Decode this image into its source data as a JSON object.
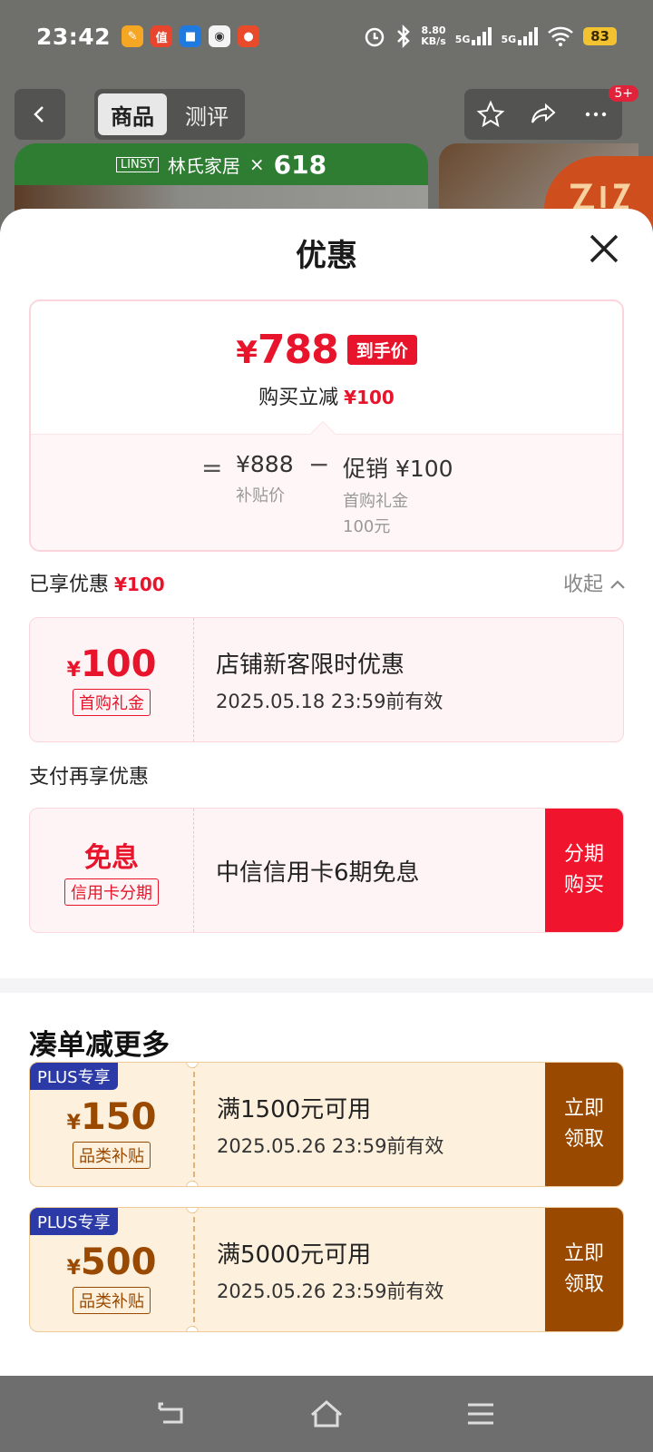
{
  "status_bar": {
    "time": "23:42",
    "net_speed_value": "8.80",
    "net_speed_unit": "KB/s",
    "sim1": "5G",
    "sim2": "5G",
    "battery": "83"
  },
  "nav": {
    "tab_product": "商品",
    "tab_review": "测评",
    "badge": "5+"
  },
  "banner": {
    "brand_en": "LINSY",
    "brand_cn": "林氏家居",
    "cross": "×",
    "event": "618"
  },
  "sheet": {
    "title": "优惠",
    "price": {
      "currency": "¥",
      "final": "788",
      "final_tag": "到手价",
      "reduce_label": "购买立减",
      "reduce_value": "¥100",
      "equals": "=",
      "subsidy_price": "¥888",
      "subsidy_label": "补贴价",
      "minus": "−",
      "promo": "促销 ¥100",
      "promo_detail_1": "首购礼金",
      "promo_detail_2": "100元"
    },
    "enjoyed": {
      "label": "已享优惠",
      "value": "¥100",
      "collapse": "收起"
    },
    "coupon_first": {
      "currency": "¥",
      "amount": "100",
      "tag": "首购礼金",
      "title": "店铺新客限时优惠",
      "validity": "2025.05.18 23:59前有效"
    },
    "pay_more_label": "支付再享优惠",
    "coupon_installment": {
      "amount_text": "免息",
      "tag": "信用卡分期",
      "title": "中信信用卡6期免息",
      "button_line1": "分期",
      "button_line2": "购买"
    },
    "more_title": "凑单减更多",
    "coupons_plus": [
      {
        "plus_tag": "PLUS专享",
        "currency": "¥",
        "amount": "150",
        "tag": "品类补贴",
        "title": "满1500元可用",
        "validity": "2025.05.26 23:59前有效",
        "button_line1": "立即",
        "button_line2": "领取"
      },
      {
        "plus_tag": "PLUS专享",
        "currency": "¥",
        "amount": "500",
        "tag": "品类补贴",
        "title": "满5000元可用",
        "validity": "2025.05.26 23:59前有效",
        "button_line1": "立即",
        "button_line2": "领取"
      }
    ]
  },
  "colors": {
    "accent_red": "#e8142c",
    "plus_blue": "#2b3aa6",
    "brown": "#9a4a00",
    "battery_yellow": "#f2c230"
  },
  "icons": [
    "back-icon",
    "star-icon",
    "share-icon",
    "more-icon",
    "close-icon",
    "chevron-up-icon",
    "nav-back-icon",
    "nav-home-icon",
    "nav-menu-icon"
  ]
}
